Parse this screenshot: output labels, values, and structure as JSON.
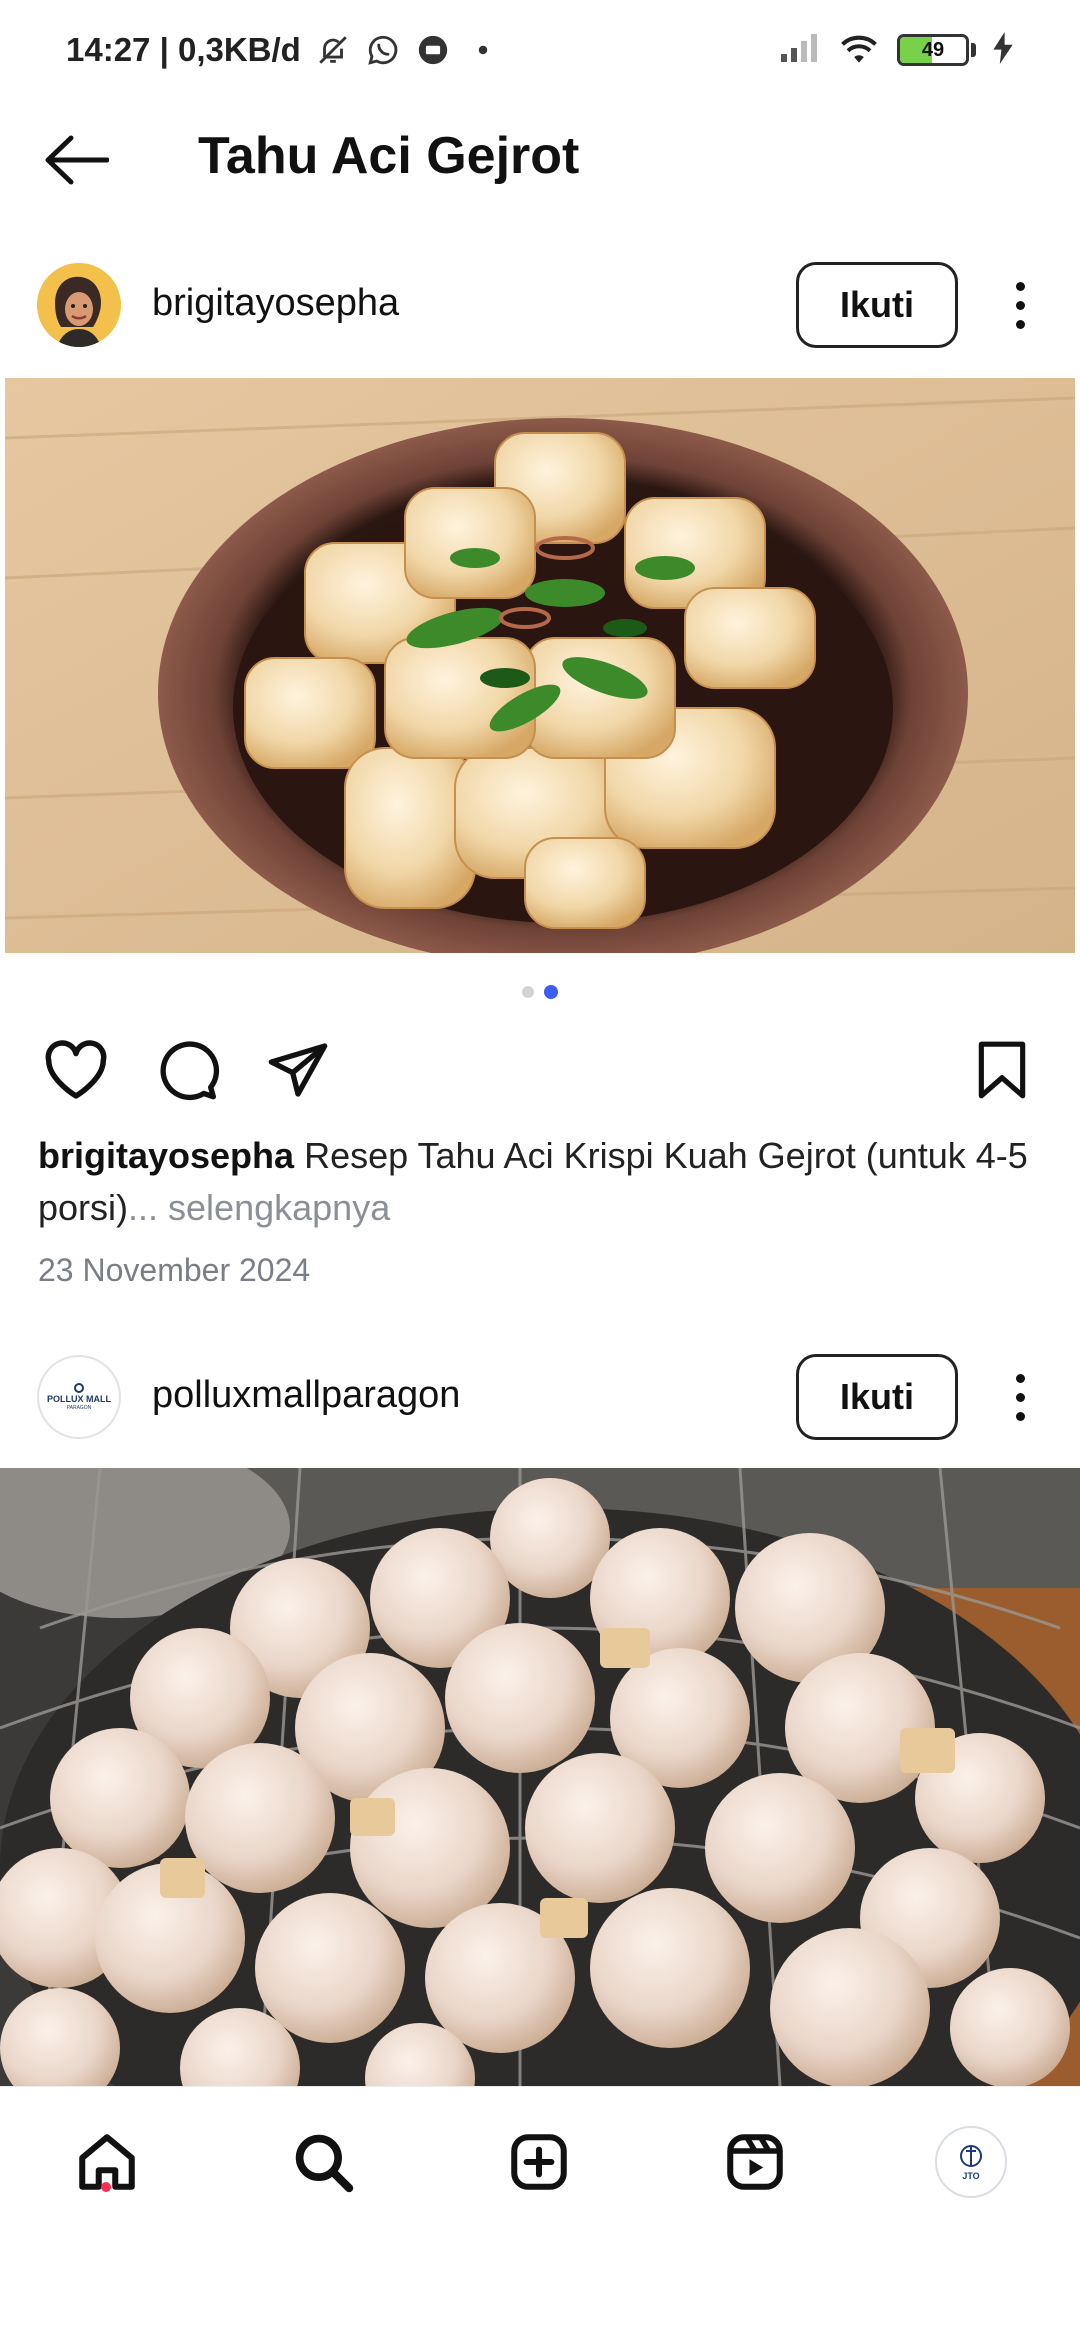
{
  "status_bar": {
    "time_data": "14:27 | 0,3KB/d",
    "battery_level": "49",
    "battery_fraction": 0.49,
    "icons": [
      "muted-icon",
      "whatsapp-icon",
      "chat-icon",
      "dot-icon",
      "signal-icon",
      "wifi-icon",
      "battery-icon",
      "charging-icon"
    ]
  },
  "header": {
    "title": "Tahu Aci Gejrot"
  },
  "posts": [
    {
      "username": "brigitayosepha",
      "follow_label": "Ikuti",
      "carousel": {
        "count": 2,
        "active": 2
      },
      "caption_user": "brigitayosepha",
      "caption_text": " Resep Tahu Aci Krispi Kuah Gejrot (untuk 4-5 porsi)",
      "caption_more": "... selengkapnya",
      "date": "23 November 2024"
    },
    {
      "username": "polluxmallparagon",
      "follow_label": "Ikuti",
      "avatar_text": "POLLUX MALL",
      "avatar_subtext": "PARAGON"
    }
  ],
  "bottom_nav": {
    "items": [
      "home-icon",
      "search-icon",
      "create-icon",
      "reels-icon",
      "profile-avatar"
    ],
    "profile_avatar_text": "JTO"
  },
  "colors": {
    "accent_blue": "#3d5cf3",
    "notification_red": "#ff2d55",
    "battery_green": "#79d04a"
  }
}
